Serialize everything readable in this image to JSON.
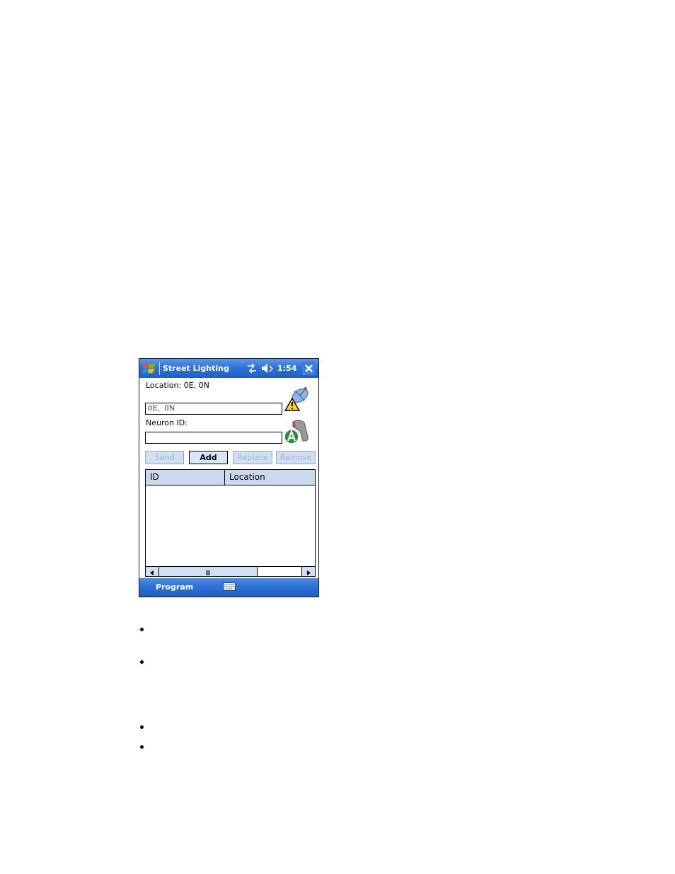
{
  "titlebar": {
    "app_title": "Street Lighting",
    "time": "1:54",
    "icons": [
      "windows-start-icon",
      "sync-icon",
      "volume-muted-icon",
      "close-icon"
    ]
  },
  "form": {
    "location_label": "Location:  0E, 0N",
    "location_value": "0E,  0N",
    "neuron_label": "Neuron ID:",
    "neuron_value": ""
  },
  "buttons": {
    "send": "Send",
    "add": "Add",
    "replace": "Replace",
    "remove": "Remove"
  },
  "table": {
    "columns": [
      "ID",
      "Location"
    ],
    "rows": []
  },
  "menubar": {
    "program": "Program"
  },
  "colors": {
    "titlebar": "#2f74d9",
    "button_face": "#d1dff2",
    "header_face": "#c9daf0",
    "disabled_text": "#a9b6c9"
  }
}
